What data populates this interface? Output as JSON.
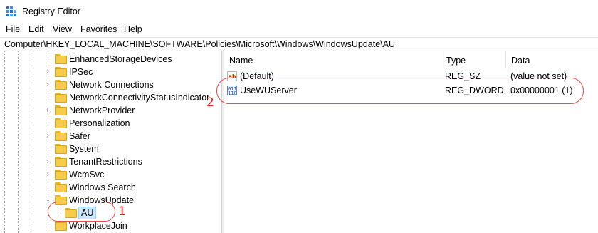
{
  "window": {
    "title": "Registry Editor"
  },
  "menu": [
    "File",
    "Edit",
    "View",
    "Favorites",
    "Help"
  ],
  "address": "Computer\\HKEY_LOCAL_MACHINE\\SOFTWARE\\Policies\\Microsoft\\Windows\\WindowsUpdate\\AU",
  "tree": {
    "items": [
      {
        "label": "EnhancedStorageDevices",
        "expandable": false
      },
      {
        "label": "IPSec",
        "expandable": true
      },
      {
        "label": "Network Connections",
        "expandable": true
      },
      {
        "label": "NetworkConnectivityStatusIndicator",
        "expandable": false
      },
      {
        "label": "NetworkProvider",
        "expandable": true
      },
      {
        "label": "Personalization",
        "expandable": false
      },
      {
        "label": "Safer",
        "expandable": true
      },
      {
        "label": "System",
        "expandable": false
      },
      {
        "label": "TenantRestrictions",
        "expandable": true
      },
      {
        "label": "WcmSvc",
        "expandable": true
      },
      {
        "label": "Windows Search",
        "expandable": false
      },
      {
        "label": "WindowsUpdate",
        "expandable": true,
        "expanded": true
      },
      {
        "label": "AU",
        "expandable": false,
        "selected": true
      },
      {
        "label": "WorkplaceJoin",
        "expandable": false
      }
    ]
  },
  "list": {
    "columns": [
      "Name",
      "Type",
      "Data"
    ],
    "rows": [
      {
        "icon": "string-value-icon",
        "name": "(Default)",
        "type": "REG_SZ",
        "data": "(value not set)"
      },
      {
        "icon": "dword-value-icon",
        "name": "UseWUServer",
        "type": "REG_DWORD",
        "data": "0x00000001 (1)"
      }
    ]
  },
  "annotations": {
    "marker_1": "1",
    "marker_2": "2",
    "color": "#e84a4a"
  },
  "colors": {
    "selection_bg": "#cce8ff",
    "folder": "#f7cc4a"
  }
}
